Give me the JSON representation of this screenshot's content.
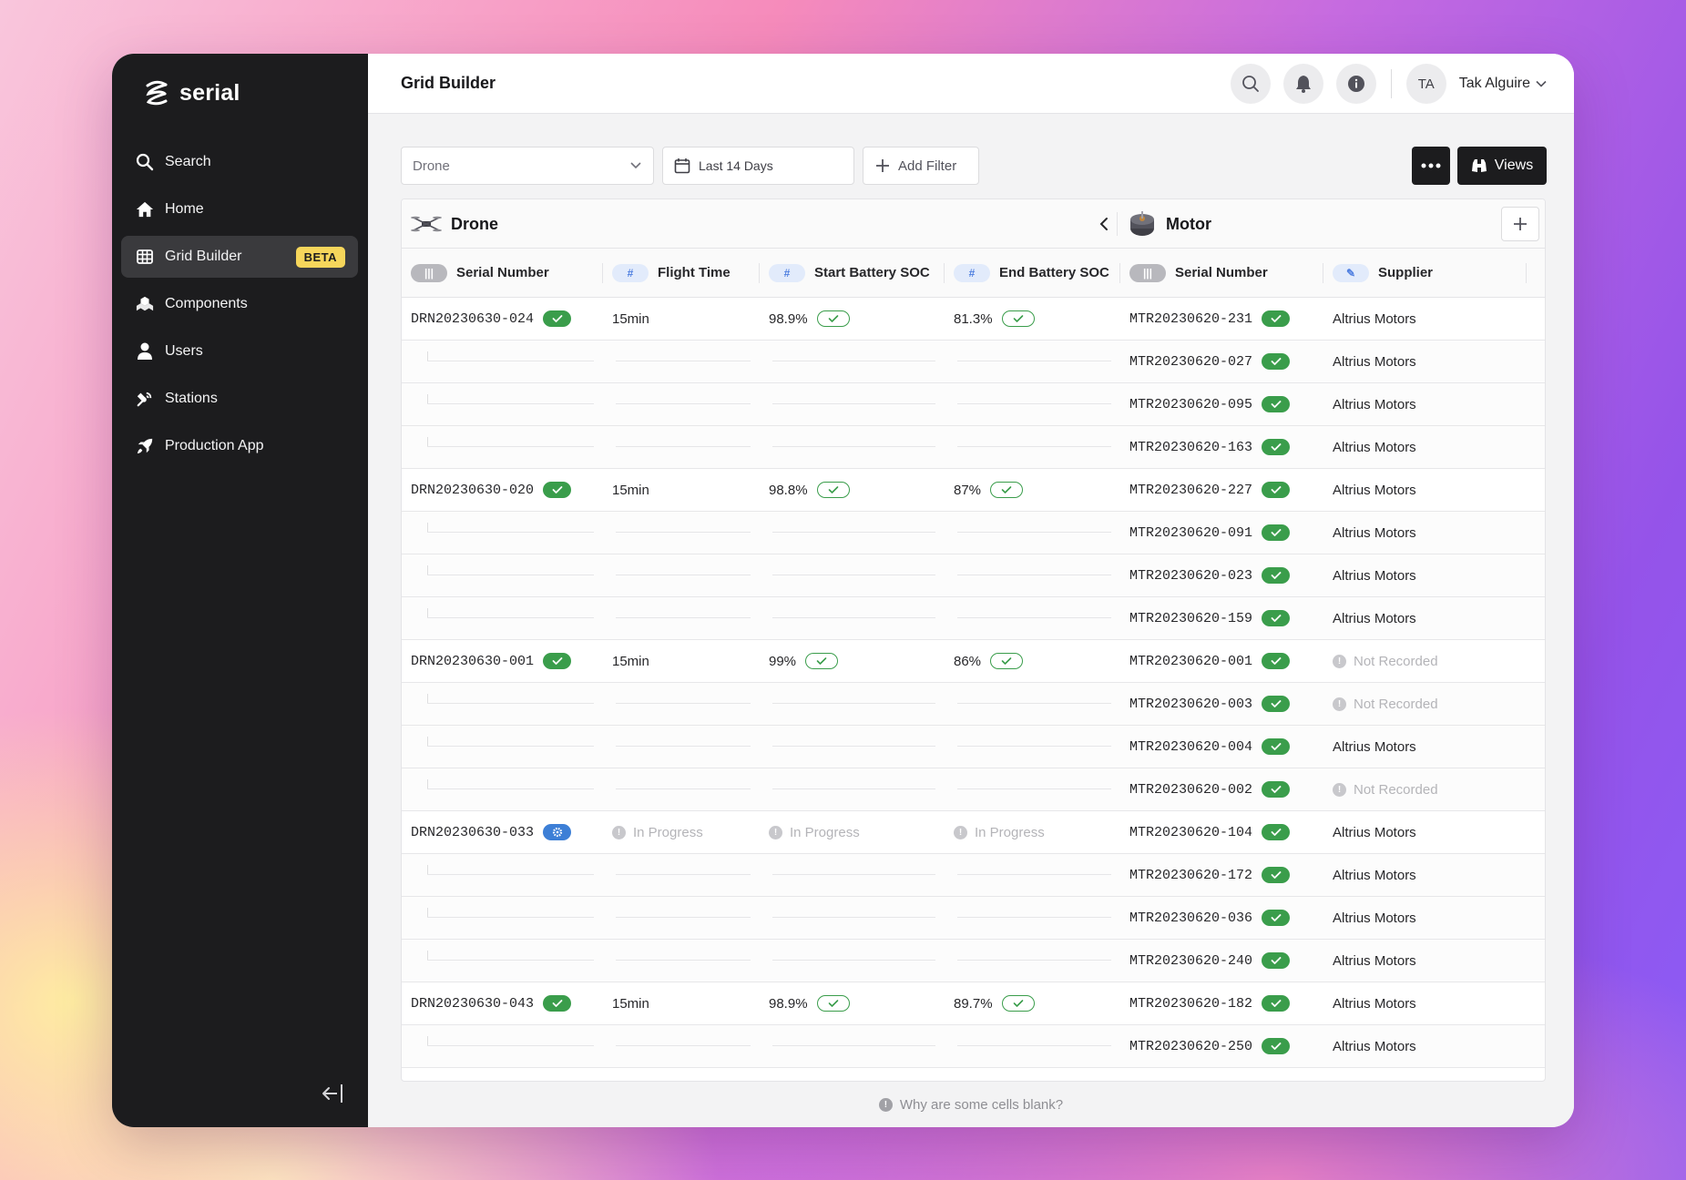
{
  "app": {
    "name": "serial"
  },
  "sidebar": {
    "items": [
      {
        "label": "Search",
        "icon": "search-icon"
      },
      {
        "label": "Home",
        "icon": "home-icon"
      },
      {
        "label": "Grid Builder",
        "icon": "grid-icon",
        "badge": "BETA",
        "active": true
      },
      {
        "label": "Components",
        "icon": "components-icon"
      },
      {
        "label": "Users",
        "icon": "user-icon"
      },
      {
        "label": "Stations",
        "icon": "stations-icon"
      },
      {
        "label": "Production App",
        "icon": "rocket-icon"
      }
    ]
  },
  "header": {
    "title": "Grid Builder",
    "user": {
      "initials": "TA",
      "name": "Tak Alguire"
    }
  },
  "toolbar": {
    "component_select": "Drone",
    "date_range": "Last 14 Days",
    "add_filter": "Add Filter",
    "views": "Views"
  },
  "groups": {
    "drone": "Drone",
    "motor": "Motor"
  },
  "columns": [
    {
      "label": "Serial Number",
      "type_icon": "barcode-icon"
    },
    {
      "label": "Flight Time",
      "type_icon": "number-icon"
    },
    {
      "label": "Start Battery SOC",
      "type_icon": "number-icon"
    },
    {
      "label": "End Battery SOC",
      "type_icon": "number-icon"
    },
    {
      "label": "Serial Number",
      "type_icon": "barcode-icon"
    },
    {
      "label": "Supplier",
      "type_icon": "pencil-icon"
    }
  ],
  "rows": [
    {
      "drone_sn": "DRN20230630-024",
      "drone_status": "complete",
      "flight_time": "15min",
      "start_soc": "98.9%",
      "end_soc": "81.3%",
      "motor_sn": "MTR20230620-231",
      "supplier": "Altrius Motors"
    },
    {
      "motor_sn": "MTR20230620-027",
      "supplier": "Altrius Motors"
    },
    {
      "motor_sn": "MTR20230620-095",
      "supplier": "Altrius Motors"
    },
    {
      "motor_sn": "MTR20230620-163",
      "supplier": "Altrius Motors"
    },
    {
      "drone_sn": "DRN20230630-020",
      "drone_status": "complete",
      "flight_time": "15min",
      "start_soc": "98.8%",
      "end_soc": "87%",
      "motor_sn": "MTR20230620-227",
      "supplier": "Altrius Motors"
    },
    {
      "motor_sn": "MTR20230620-091",
      "supplier": "Altrius Motors"
    },
    {
      "motor_sn": "MTR20230620-023",
      "supplier": "Altrius Motors"
    },
    {
      "motor_sn": "MTR20230620-159",
      "supplier": "Altrius Motors"
    },
    {
      "drone_sn": "DRN20230630-001",
      "drone_status": "complete",
      "flight_time": "15min",
      "start_soc": "99%",
      "end_soc": "86%",
      "motor_sn": "MTR20230620-001",
      "supplier_missing": "Not Recorded"
    },
    {
      "motor_sn": "MTR20230620-003",
      "supplier_missing": "Not Recorded"
    },
    {
      "motor_sn": "MTR20230620-004",
      "supplier": "Altrius Motors"
    },
    {
      "motor_sn": "MTR20230620-002",
      "supplier_missing": "Not Recorded"
    },
    {
      "drone_sn": "DRN20230630-033",
      "drone_status": "in-progress",
      "in_progress": "In Progress",
      "motor_sn": "MTR20230620-104",
      "supplier": "Altrius Motors"
    },
    {
      "motor_sn": "MTR20230620-172",
      "supplier": "Altrius Motors"
    },
    {
      "motor_sn": "MTR20230620-036",
      "supplier": "Altrius Motors"
    },
    {
      "motor_sn": "MTR20230620-240",
      "supplier": "Altrius Motors"
    },
    {
      "drone_sn": "DRN20230630-043",
      "drone_status": "complete",
      "flight_time": "15min",
      "start_soc": "98.9%",
      "end_soc": "89.7%",
      "motor_sn": "MTR20230620-182",
      "supplier": "Altrius Motors"
    },
    {
      "motor_sn": "MTR20230620-250",
      "supplier": "Altrius Motors"
    }
  ],
  "footer_hint": "Why are some cells blank?",
  "colors": {
    "sidebar": "#1c1c1e",
    "success": "#3a9d4b",
    "progress": "#3d7fd6",
    "beta": "#f6d65b"
  }
}
